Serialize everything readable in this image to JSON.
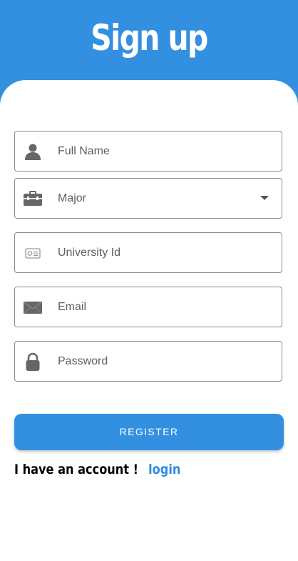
{
  "header": {
    "title": "Sign up",
    "color": "#3390e0"
  },
  "form": {
    "full_name": {
      "placeholder": "Full Name",
      "icon": "person-icon"
    },
    "major": {
      "placeholder": "Major",
      "icon": "briefcase-icon"
    },
    "university_id": {
      "placeholder": "University Id",
      "icon": "id-card-icon"
    },
    "email": {
      "placeholder": "Email",
      "icon": "envelope-icon"
    },
    "password": {
      "placeholder": "Password",
      "icon": "lock-icon"
    }
  },
  "register_button": {
    "label": "REGISTER"
  },
  "footer": {
    "prompt": "I have an account !",
    "login_link": "login",
    "link_color": "#2f8ae0"
  }
}
